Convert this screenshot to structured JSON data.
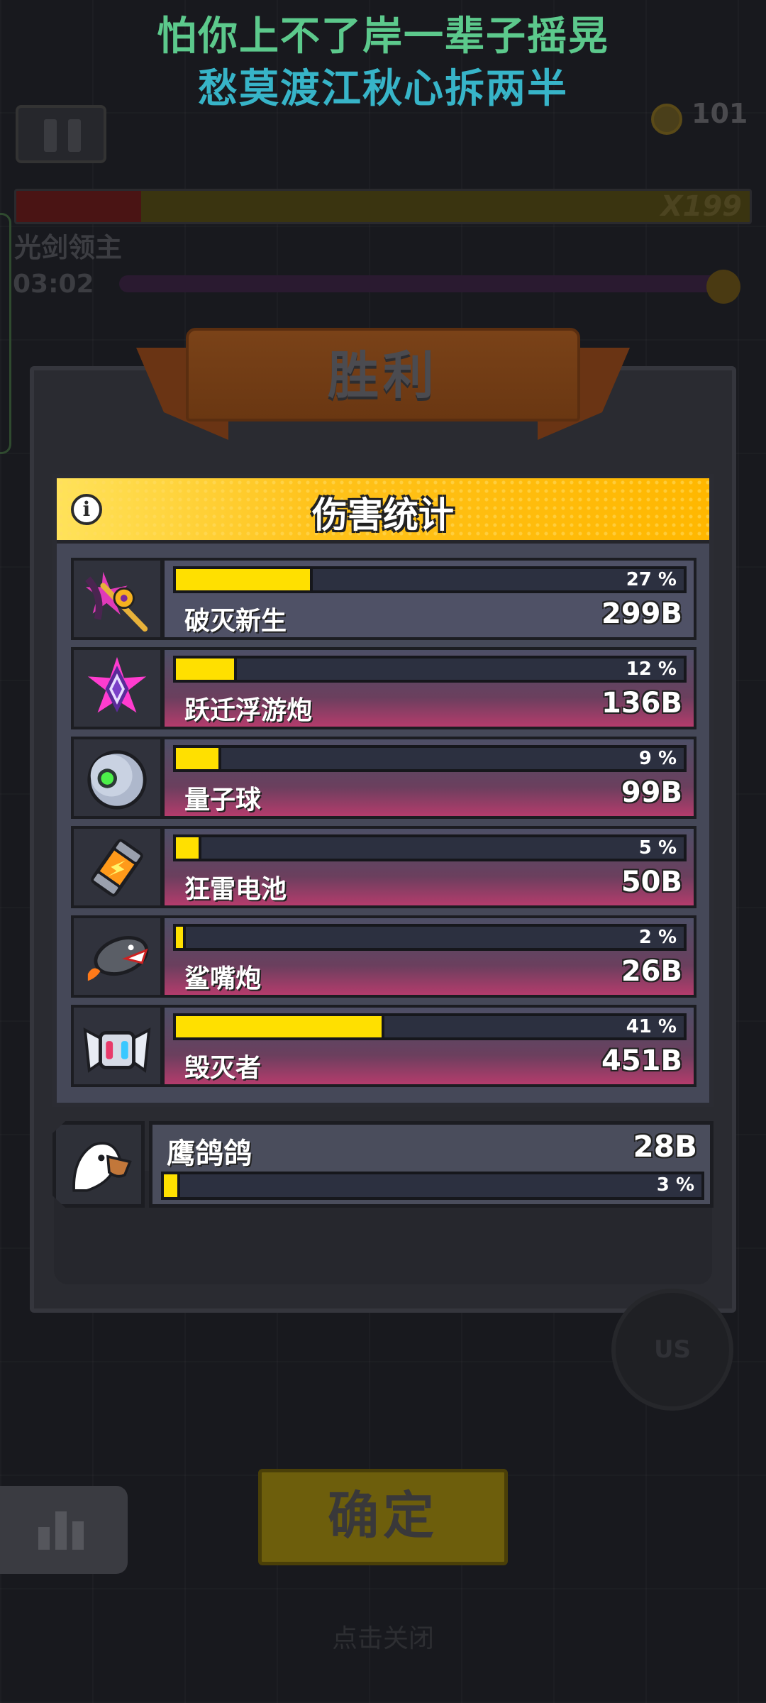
{
  "lyrics": {
    "line1": "怕你上不了岸一辈子摇晃",
    "line2": "愁莫渡江秋心拆两半"
  },
  "hud": {
    "coin_count": "101",
    "multiplier": "X199",
    "boss_name": "光剑领主",
    "timer": "03:02"
  },
  "victory_title": "胜利",
  "damage_stats": {
    "title": "伤害统计",
    "weapons": [
      {
        "name": "破灭新生",
        "percent": "27 %",
        "fraction": 0.27,
        "damage": "299B",
        "icon": "star-sword-icon"
      },
      {
        "name": "跃迁浮游炮",
        "percent": "12 %",
        "fraction": 0.12,
        "damage": "136B",
        "icon": "warp-crystal-icon"
      },
      {
        "name": "量子球",
        "percent": "9 %",
        "fraction": 0.09,
        "damage": "99B",
        "icon": "quantum-orb-icon"
      },
      {
        "name": "狂雷电池",
        "percent": "5 %",
        "fraction": 0.05,
        "damage": "50B",
        "icon": "thunder-battery-icon"
      },
      {
        "name": "鲨嘴炮",
        "percent": "2 %",
        "fraction": 0.02,
        "damage": "26B",
        "icon": "shark-cannon-icon"
      },
      {
        "name": "毁灭者",
        "percent": "41 %",
        "fraction": 0.41,
        "damage": "451B",
        "icon": "destroyer-drone-icon"
      }
    ]
  },
  "companion": {
    "name": "鹰鸽鸽",
    "damage": "28B",
    "percent": "3 %",
    "fraction": 0.03,
    "icon": "eagle-icon"
  },
  "compass_label": "US",
  "confirm_label": "确定",
  "close_hint": "点击关闭",
  "colors": {
    "bar_fill": "#ffe000",
    "header_yellow": "#ffc21a",
    "accent_pink": "#b43c6c"
  }
}
